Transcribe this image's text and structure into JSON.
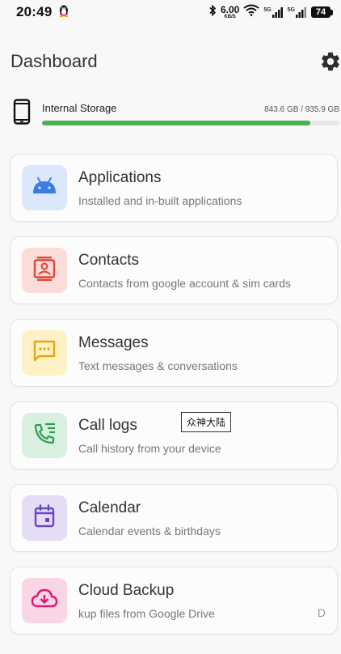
{
  "status_bar": {
    "time": "20:49",
    "speed_value": "6.00",
    "speed_unit": "KB/S",
    "network_1": "5G",
    "network_2": "5G",
    "battery": "74"
  },
  "header": {
    "title": "Dashboard",
    "settings_icon": "gear-icon"
  },
  "storage": {
    "label": "Internal Storage",
    "size": "843.6 GB / 935.9 GB",
    "used_fraction": 0.901,
    "bar_color": "#4caf50"
  },
  "cards": [
    {
      "title": "Applications",
      "subtitle": "Installed and in-built applications",
      "icon": "android-icon",
      "icon_bg": "#dbe8fb",
      "icon_color": "#3c7be0"
    },
    {
      "title": "Contacts",
      "subtitle": "Contacts from google account & sim cards",
      "icon": "contacts-icon",
      "icon_bg": "#fbdcd9",
      "icon_color": "#e0473a"
    },
    {
      "title": "Messages",
      "subtitle": "Text messages & conversations",
      "icon": "message-icon",
      "icon_bg": "#fdf1c6",
      "icon_color": "#e6a413"
    },
    {
      "title": "Call logs",
      "subtitle": "Call history from your device",
      "icon": "call-log-icon",
      "icon_bg": "#d9f0e0",
      "icon_color": "#2e9b52"
    },
    {
      "title": "Calendar",
      "subtitle": "Calendar events & birthdays",
      "icon": "calendar-icon",
      "icon_bg": "#e4ddf5",
      "icon_color": "#6a46c2"
    },
    {
      "title": "Cloud Backup",
      "subtitle": "kup files from Google Drive",
      "trailing": "D",
      "icon": "cloud-download-icon",
      "icon_bg": "#fad5e6",
      "icon_color": "#d81b72"
    }
  ],
  "toast": {
    "text": "众神大陆"
  }
}
